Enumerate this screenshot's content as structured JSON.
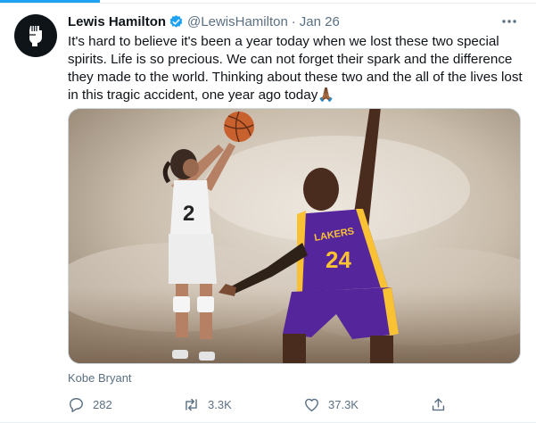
{
  "tweet": {
    "author_name": "Lewis Hamilton",
    "verified_icon": "verified-badge-icon",
    "handle": "@LewisHamilton",
    "separator": "·",
    "date": "Jan 26",
    "text": "It's hard to believe it's been a year today when we lost these two special spirits. Life is so precious. We can not forget their spark and the difference they made to the world. Thinking about these two and the all of the lives lost in this tragic accident, one year ago today🙏🏾",
    "image_description_icon": "photo",
    "image_jerseys": {
      "girl": "2",
      "lakers_text": "LAKERS",
      "man": "24"
    },
    "tagged_person": "Kobe Bryant"
  },
  "actions": {
    "replies": "282",
    "retweets": "3.3K",
    "likes": "37.3K"
  },
  "colors": {
    "accent": "#1da1f2",
    "muted": "#5b7083",
    "text": "#0f1419",
    "lakers_purple": "#55259b",
    "lakers_gold": "#f9c234"
  }
}
